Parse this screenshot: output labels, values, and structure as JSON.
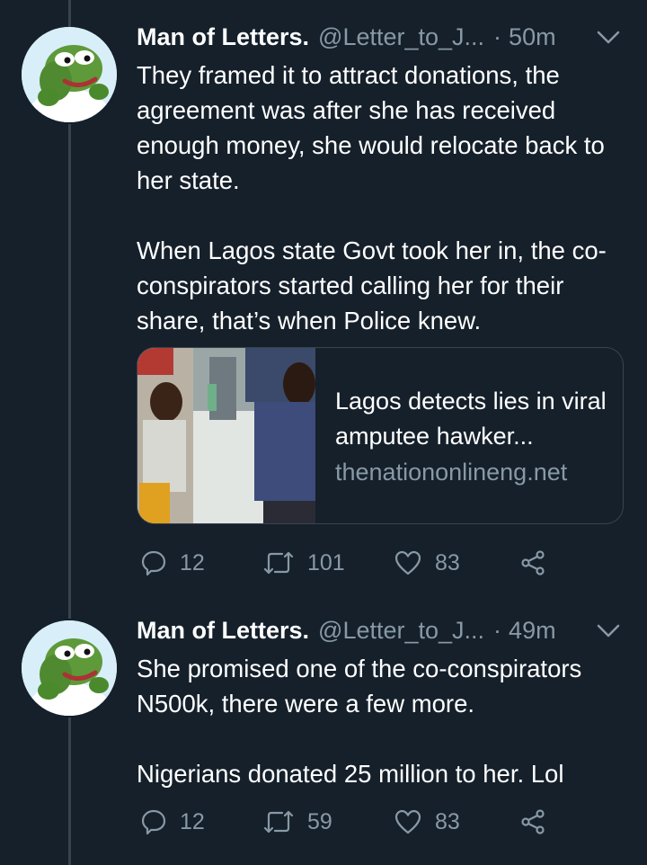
{
  "tweets": [
    {
      "name": "Man of Letters.",
      "handle": "@Letter_to_J...",
      "separator": "·",
      "time": "50m",
      "paragraphs": [
        "They framed it to attract donations, the agreement was after she has received enough money, she would relocate back to her state.",
        "When Lagos state Govt took her in, the co-conspirators started calling her for their share, that’s when Police knew."
      ],
      "card": {
        "title": "Lagos detects lies in viral amputee hawker...",
        "domain": "thenationonlineng.net"
      },
      "replies": "12",
      "retweets": "101",
      "likes": "83"
    },
    {
      "name": "Man of Letters.",
      "handle": "@Letter_to_J...",
      "separator": "·",
      "time": "49m",
      "paragraphs": [
        "She promised one of the co-conspirators N500k, there were a few more.",
        "Nigerians donated 25 million to her. Lol"
      ],
      "replies": "12",
      "retweets": "59",
      "likes": "83"
    }
  ],
  "icons": {
    "reply": "reply-icon",
    "retweet": "retweet-icon",
    "like": "heart-icon",
    "share": "share-icon",
    "menu": "chevron-down-icon"
  },
  "colors": {
    "background": "#15202b",
    "secondary_text": "#8899a6",
    "border": "#38444d"
  }
}
